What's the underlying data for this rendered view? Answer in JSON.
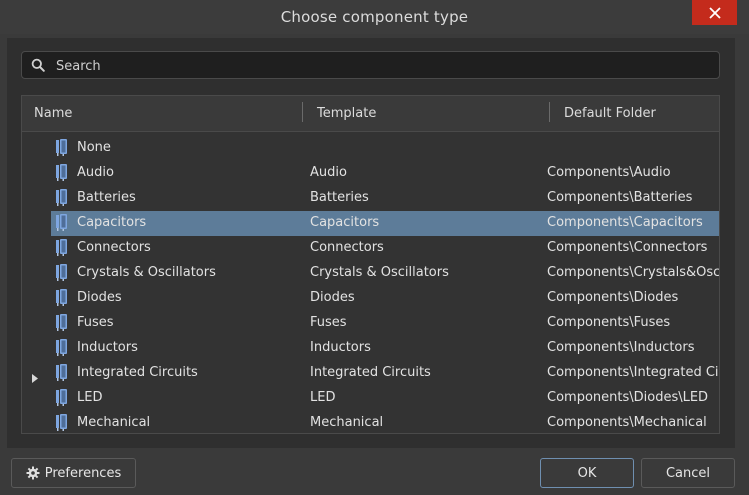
{
  "window": {
    "title": "Choose component type",
    "close_icon": "close-icon"
  },
  "search": {
    "placeholder": "Search",
    "value": "",
    "icon": "search-icon"
  },
  "table": {
    "columns": [
      "Name",
      "Template",
      "Default Folder"
    ],
    "selected_row": "Capacitors",
    "rows": [
      {
        "name": "None",
        "template": "",
        "folder": "",
        "expandable": false
      },
      {
        "name": "Audio",
        "template": "Audio",
        "folder": "Components\\Audio",
        "expandable": false
      },
      {
        "name": "Batteries",
        "template": "Batteries",
        "folder": "Components\\Batteries",
        "expandable": false
      },
      {
        "name": "Capacitors",
        "template": "Capacitors",
        "folder": "Components\\Capacitors",
        "expandable": false
      },
      {
        "name": "Connectors",
        "template": "Connectors",
        "folder": "Components\\Connectors",
        "expandable": false
      },
      {
        "name": "Crystals & Oscillators",
        "template": "Crystals & Oscillators",
        "folder": "Components\\Crystals&Oscil",
        "expandable": false
      },
      {
        "name": "Diodes",
        "template": "Diodes",
        "folder": "Components\\Diodes",
        "expandable": false
      },
      {
        "name": "Fuses",
        "template": "Fuses",
        "folder": "Components\\Fuses",
        "expandable": false
      },
      {
        "name": "Inductors",
        "template": "Inductors",
        "folder": "Components\\Inductors",
        "expandable": false
      },
      {
        "name": "Integrated Circuits",
        "template": "Integrated Circuits",
        "folder": "Components\\Integrated Circ",
        "expandable": true
      },
      {
        "name": "LED",
        "template": "LED",
        "folder": "Components\\Diodes\\LED",
        "expandable": false
      },
      {
        "name": "Mechanical",
        "template": "Mechanical",
        "folder": "Components\\Mechanical",
        "expandable": false
      }
    ]
  },
  "footer": {
    "preferences_label": "Preferences",
    "ok_label": "OK",
    "cancel_label": "Cancel"
  },
  "colors": {
    "background": "#3a3a3a",
    "selection": "#5d7c99",
    "close_button": "#c42b1c",
    "component_icon": "#7ea6e0"
  }
}
